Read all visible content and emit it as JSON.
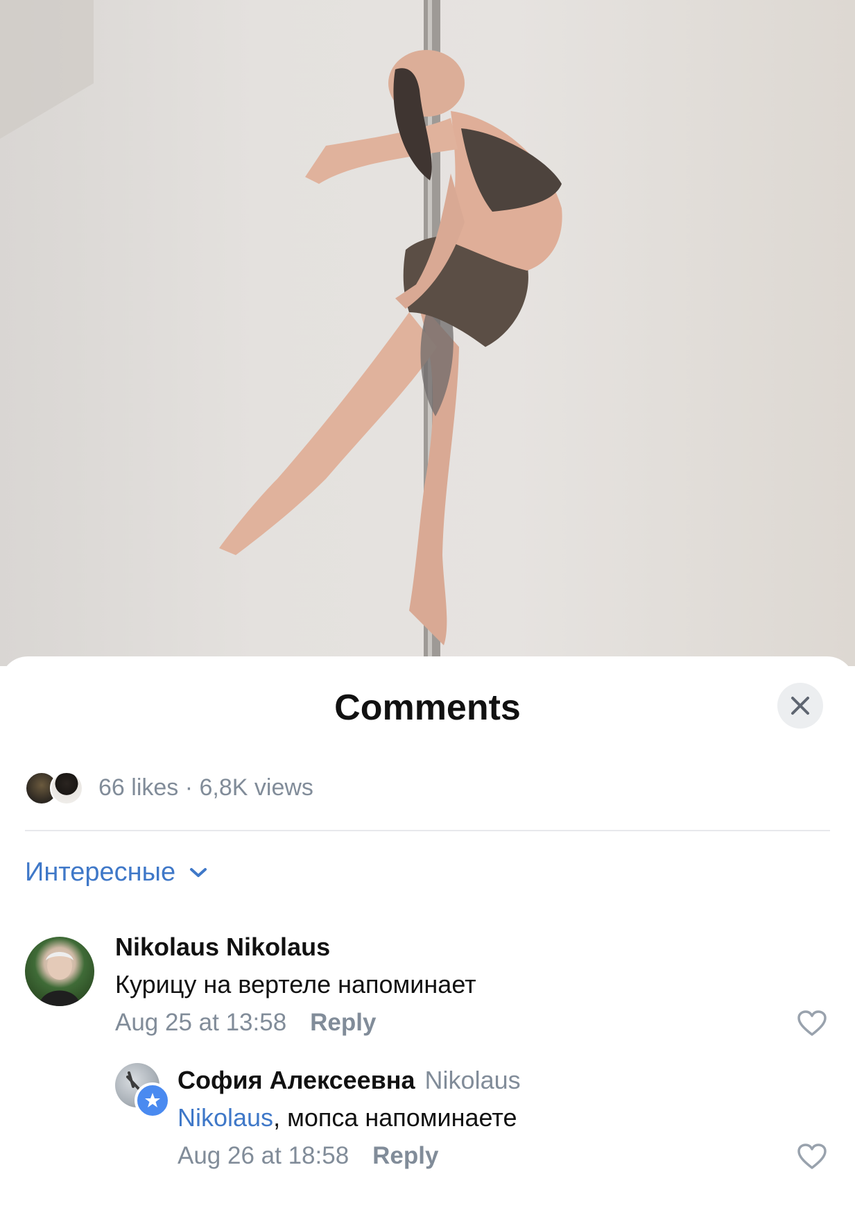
{
  "sheet": {
    "title": "Comments",
    "close_icon": "close-icon"
  },
  "stats": {
    "text": "66 likes · 6,8K views"
  },
  "sort": {
    "label": "Интересные",
    "icon": "chevron-down-icon"
  },
  "comments": [
    {
      "author": "Nikolaus Nikolaus",
      "text": "Курицу на вертеле напоминает",
      "time": "Aug 25 at 13:58",
      "reply_label": "Reply",
      "like_icon": "heart-icon"
    },
    {
      "author": "София Алексеевна",
      "reply_to": "Nikolaus",
      "mention": "Nikolaus",
      "text": ", мопса напоминаете",
      "time": "Aug 26 at 18:58",
      "reply_label": "Reply",
      "like_icon": "heart-icon",
      "badge_icon": "star-badge-icon"
    }
  ],
  "colors": {
    "accent": "#3f78c8",
    "secondary_text": "#818c99",
    "divider": "#e7e8ec"
  }
}
